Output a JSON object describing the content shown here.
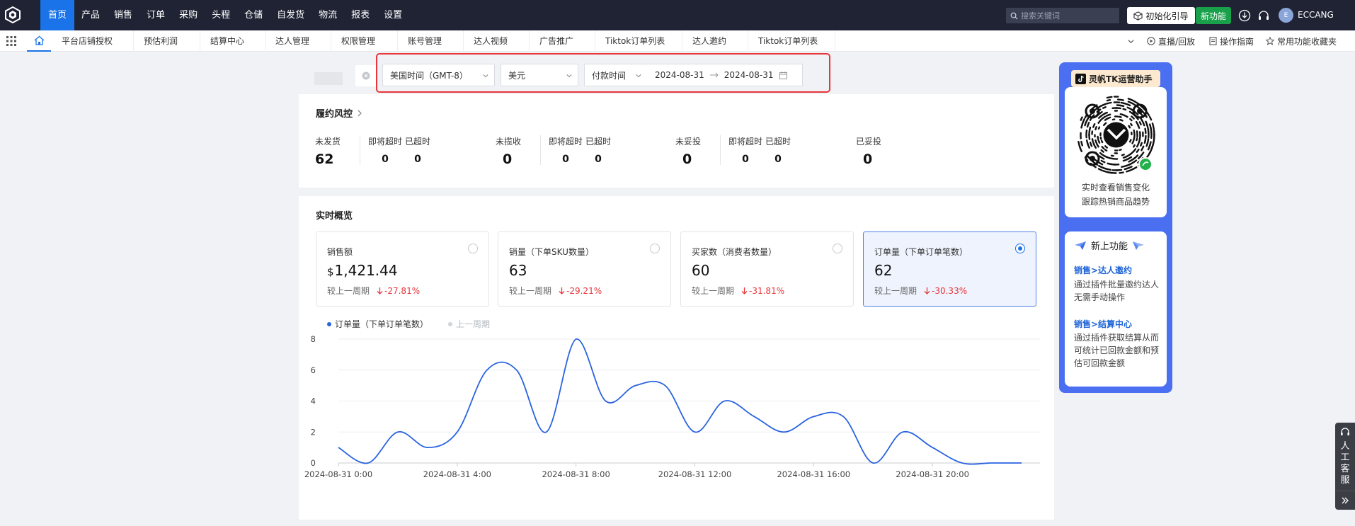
{
  "topnav": {
    "menu": [
      {
        "label": "首页",
        "active": true
      },
      {
        "label": "产品"
      },
      {
        "label": "销售"
      },
      {
        "label": "订单"
      },
      {
        "label": "采购"
      },
      {
        "label": "头程"
      },
      {
        "label": "仓储"
      },
      {
        "label": "自发货"
      },
      {
        "label": "物流"
      },
      {
        "label": "报表"
      },
      {
        "label": "设置"
      }
    ],
    "search_placeholder": "搜索关键词",
    "init_guide_label": "初始化引导",
    "new_feature_label": "新功能",
    "avatar_text": "E",
    "username": "ECCANG"
  },
  "subnav": {
    "tabs": [
      "平台店铺授权",
      "预估利润",
      "结算中心",
      "达人管理",
      "权限管理",
      "账号管理",
      "达人视频",
      "广告推广",
      "Tiktok订单列表",
      "达人邀约",
      "Tiktok订单列表"
    ],
    "live_replay": "直播/回放",
    "guide": "操作指南",
    "favorites": "常用功能收藏夹"
  },
  "filters": {
    "timezone": "美国时间（GMT-8）",
    "currency": "美元",
    "time_type": "付款时间",
    "date_start": "2024-08-31",
    "date_end": "2024-08-31"
  },
  "risk": {
    "title": "履约风控",
    "groups": [
      {
        "main_label": "未发货",
        "main_value": "62",
        "sub": [
          {
            "label": "即将超时",
            "value": "0"
          },
          {
            "label": "已超时",
            "value": "0"
          }
        ]
      },
      {
        "main_label": "未揽收",
        "main_value": "0",
        "sub": [
          {
            "label": "即将超时",
            "value": "0"
          },
          {
            "label": "已超时",
            "value": "0"
          }
        ]
      },
      {
        "main_label": "未妥投",
        "main_value": "0",
        "sub": [
          {
            "label": "即将超时",
            "value": "0"
          },
          {
            "label": "已超时",
            "value": "0"
          }
        ]
      },
      {
        "main_label": "已妥投",
        "main_value": "0"
      }
    ]
  },
  "realtime": {
    "title": "实时概览",
    "compare_label": "较上一周期",
    "metrics": [
      {
        "label": "销售额",
        "currency": "$",
        "value": "1,421.44",
        "change": "-27.81%",
        "selected": false
      },
      {
        "label": "销量（下单SKU数量）",
        "value": "63",
        "change": "-29.21%",
        "selected": false
      },
      {
        "label": "买家数（消费者数量）",
        "value": "60",
        "change": "-31.81%",
        "selected": false
      },
      {
        "label": "订单量（下单订单笔数）",
        "value": "62",
        "change": "-30.33%",
        "selected": true
      }
    ]
  },
  "chart_data": {
    "type": "line",
    "x": [
      0,
      1,
      2,
      3,
      4,
      5,
      6,
      7,
      8,
      9,
      10,
      11,
      12,
      13,
      14,
      15,
      16,
      17,
      18,
      19,
      20,
      21,
      22,
      23
    ],
    "x_tick_labels": [
      "2024-08-31 0:00",
      "2024-08-31 4:00",
      "2024-08-31 8:00",
      "2024-08-31 12:00",
      "2024-08-31 16:00",
      "2024-08-31 20:00"
    ],
    "x_tick_positions": [
      0,
      4,
      8,
      12,
      16,
      20
    ],
    "series": [
      {
        "name": "订单量（下单订单笔数）",
        "color": "#2a63e0",
        "values": [
          1,
          0,
          2,
          1,
          2,
          6,
          6,
          2,
          8,
          4,
          5,
          5,
          2,
          4,
          3,
          2,
          3,
          3,
          0,
          2,
          1,
          0,
          0,
          0
        ]
      },
      {
        "name": "上一周期",
        "color": "#d0d3d8",
        "values": []
      }
    ],
    "ylim": [
      0,
      8
    ],
    "y_ticks": [
      0,
      2,
      4,
      6,
      8
    ],
    "grid": true,
    "legend_position": "top-left"
  },
  "promo": {
    "title": "灵帆TK运营助手",
    "desc_line1": "实时查看销售变化",
    "desc_line2": "跟踪热销商品趋势",
    "new_title": "新上功能",
    "features": [
      {
        "link": "销售>达人邀约",
        "desc": "通过插件批量邀约达人 无需手动操作"
      },
      {
        "link": "销售>结算中心",
        "desc": "通过插件获取结算从而可统计已回款金额和预估可回款金额"
      }
    ]
  },
  "customer_service": "人工客服",
  "colors": {
    "nav_bg": "#1f2334",
    "accent": "#1a73e8",
    "danger": "#e8363b",
    "success": "#19a04a",
    "promo_bg": "#4a6ff0"
  }
}
